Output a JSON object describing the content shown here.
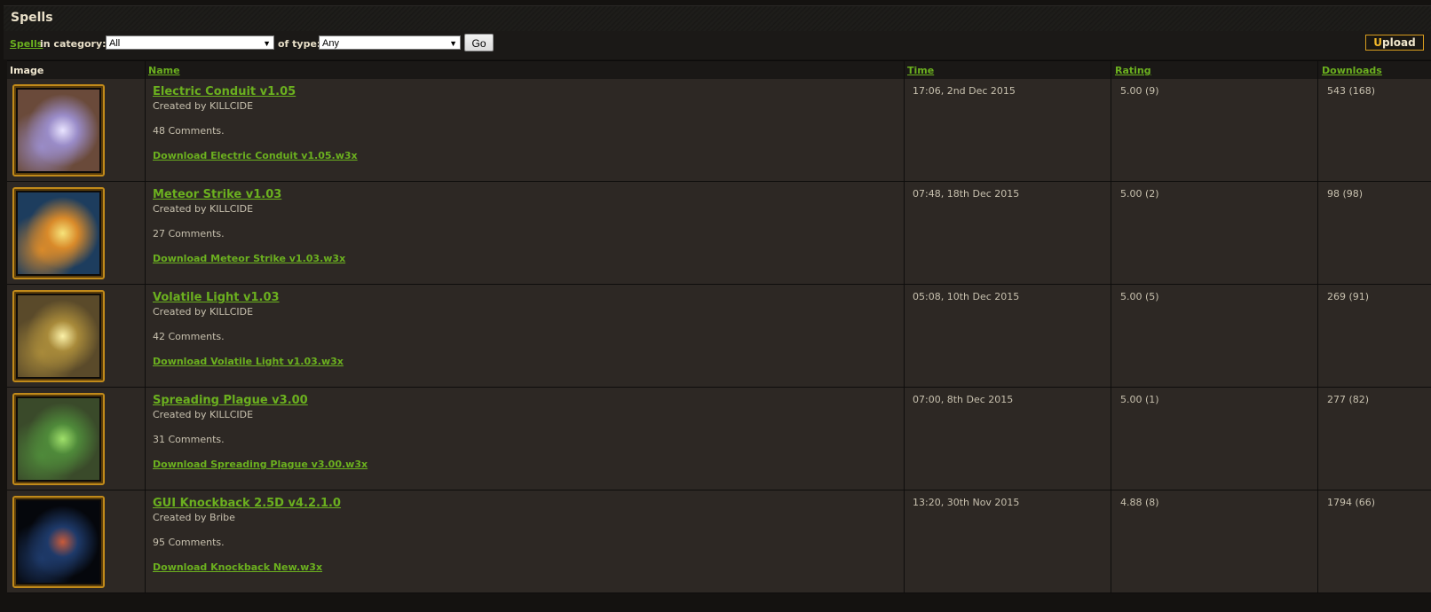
{
  "header": {
    "title": "Spells"
  },
  "filter": {
    "spells_link": "Spells",
    "category_label": "in category:",
    "category_value": "All",
    "type_label": "of type:",
    "type_value": "Any",
    "go_label": "Go",
    "upload_first": "U",
    "upload_rest": "pload"
  },
  "columns": {
    "image": "Image",
    "name": "Name",
    "time": "Time",
    "rating": "Rating",
    "downloads": "Downloads"
  },
  "items": [
    {
      "title": "Electric Conduit v1.05",
      "created": "Created by KILLCIDE",
      "comments": "48 Comments.",
      "download": "Download Electric Conduit v1.05.w3x",
      "time": "17:06, 2nd Dec 2015",
      "rating": "5.00 (9)",
      "downloads": "543 (168)",
      "thumb_colors": [
        "#6a4a3a",
        "#9a8cc8",
        "#e9e4ff"
      ]
    },
    {
      "title": "Meteor Strike v1.03",
      "created": "Created by KILLCIDE",
      "comments": "27 Comments.",
      "download": "Download Meteor Strike v1.03.w3x",
      "time": "07:48, 18th Dec 2015",
      "rating": "5.00 (2)",
      "downloads": "98 (98)",
      "thumb_colors": [
        "#1d3d5e",
        "#d98a2a",
        "#f6e37a"
      ]
    },
    {
      "title": "Volatile Light v1.03",
      "created": "Created by KILLCIDE",
      "comments": "42 Comments.",
      "download": "Download Volatile Light v1.03.w3x",
      "time": "05:08, 10th Dec 2015",
      "rating": "5.00 (5)",
      "downloads": "269 (91)",
      "thumb_colors": [
        "#5a4a2a",
        "#a88a3a",
        "#fbf1a8"
      ]
    },
    {
      "title": "Spreading Plague v3.00",
      "created": "Created by KILLCIDE",
      "comments": "31 Comments.",
      "download": "Download Spreading Plague v3.00.w3x",
      "time": "07:00, 8th Dec 2015",
      "rating": "5.00 (1)",
      "downloads": "277 (82)",
      "thumb_colors": [
        "#3a4a2a",
        "#4f8a3a",
        "#9fe06a"
      ]
    },
    {
      "title": "GUI Knockback 2.5D v4.2.1.0",
      "created": "Created by Bribe",
      "comments": "95 Comments.",
      "download": "Download Knockback New.w3x",
      "time": "13:20, 30th Nov 2015",
      "rating": "4.88 (8)",
      "downloads": "1794 (66)",
      "thumb_colors": [
        "#05070c",
        "#1e3a6a",
        "#c85a3a"
      ]
    }
  ]
}
